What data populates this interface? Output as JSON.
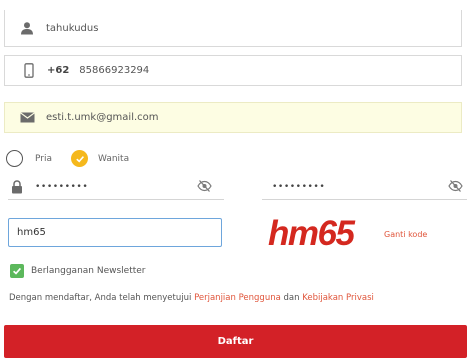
{
  "form": {
    "username": {
      "value": "tahukudus",
      "icon": "user-icon"
    },
    "phone": {
      "country_code": "+62",
      "value": "85866923294",
      "icon": "mobile-phone-icon"
    },
    "email": {
      "value": "esti.t.umk@gmail.com",
      "icon": "envelope-icon"
    },
    "gender": {
      "options": [
        {
          "label": "Pria",
          "selected": false
        },
        {
          "label": "Wanita",
          "selected": true
        }
      ]
    },
    "password": {
      "value": "•••••••••",
      "icon": "lock-icon"
    },
    "password_confirm": {
      "value": "•••••••••"
    },
    "captcha": {
      "input_value": "hm65",
      "image_text": "hm65",
      "change_label": "Ganti kode"
    },
    "newsletter": {
      "label": "Berlangganan Newsletter",
      "checked": true
    },
    "terms": {
      "prefix": "Dengan mendaftar, Anda telah menyetujui ",
      "link1": "Perjanjian Pengguna",
      "middle": " dan ",
      "link2": "Kebijakan Privasi"
    },
    "submit_label": "Daftar"
  },
  "colors": {
    "primary_red": "#d32127",
    "link_orange": "#e0553b",
    "radio_selected": "#f5b81c",
    "checkbox_green": "#5cb85c",
    "autofill_yellow": "#fdfde3",
    "captcha_red": "#d4281f"
  }
}
